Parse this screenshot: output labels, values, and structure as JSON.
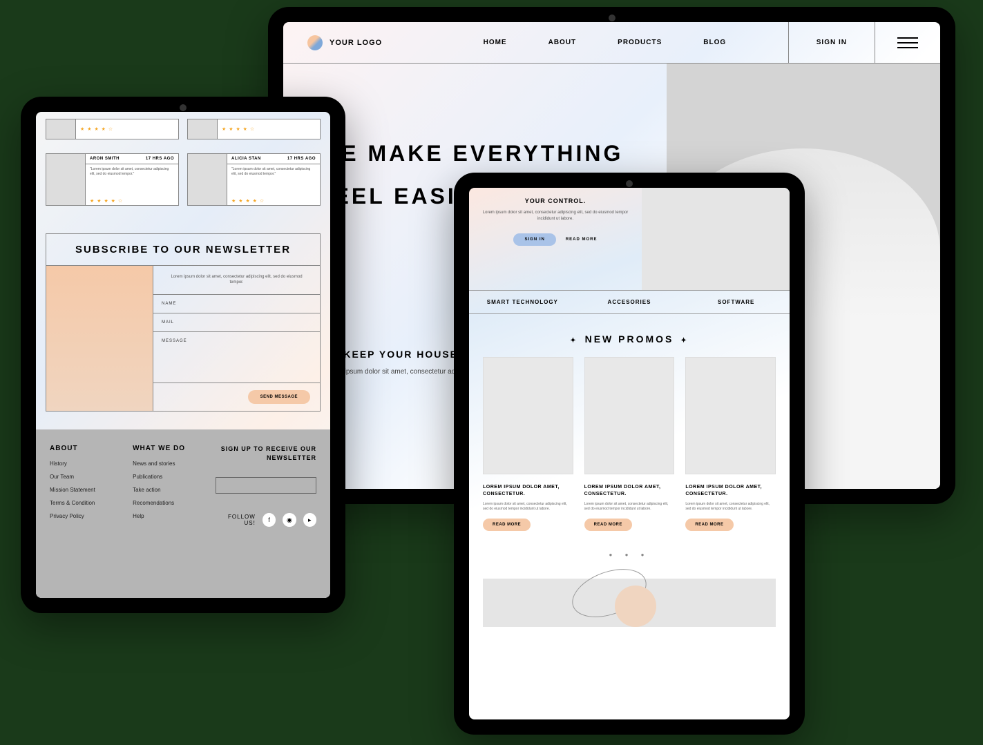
{
  "a": {
    "logo": "YOUR LOGO",
    "nav": {
      "home": "HOME",
      "about": "ABOUT",
      "products": "PRODUCTS",
      "blog": "BLOG"
    },
    "signin": "SIGN IN",
    "hero_title_1": "WE MAKE EVERYTHING",
    "hero_title_2": "FEEL EASIER",
    "sub_title": "KEEP YOUR HOUSE UNDER YOUR CONTROL.",
    "sub_body": "Lorem ipsum dolor sit amet, consectetur adipiscing elit, sed do eiusmod tempor incididunt ut labore."
  },
  "b": {
    "reviews": [
      {
        "name": "ARON SMITH",
        "time": "17 HRS AGO",
        "text": "\"Lorem ipsum dolor sit amet, consectetur adipiscing elit, sed do eiusmod tempor.\"",
        "stars": "★ ★ ★ ★ ☆"
      },
      {
        "name": "ALICIA STAN",
        "time": "17 HRS AGO",
        "text": "\"Lorem ipsum dolor sit amet, consectetur adipiscing elit, sed do eiusmod tempor.\"",
        "stars": "★ ★ ★ ★ ☆"
      }
    ],
    "top_stars": "★ ★ ★ ★ ☆",
    "newsletter": {
      "title": "SUBSCRIBE TO OUR NEWSLETTER",
      "desc": "Lorem ipsum dolor sit amet, consectetur adipiscing elit, sed do eiusmod tempor.",
      "name": "NAME",
      "mail": "MAIL",
      "message": "MESSAGE",
      "send": "SEND MESSAGE"
    },
    "footer": {
      "about_h": "ABOUT",
      "about": [
        "History",
        "Our Team",
        "Mission Statement",
        "Terms & Condition",
        "Privacy Policy"
      ],
      "what_h": "WHAT WE DO",
      "what": [
        "News and stories",
        "Publications",
        "Take action",
        "Recomendations",
        "Help"
      ],
      "signup": "SIGN UP TO RECEIVE OUR NEWSLETTER",
      "follow": "FOLLOW US!"
    }
  },
  "c": {
    "hero_title": "YOUR CONTROL.",
    "hero_body": "Lorem ipsum dolor sit amet, consectetur adipiscing elit, sed do eiusmod tempor incididunt ut labore.",
    "signin": "SIGN IN",
    "readmore": "READ MORE",
    "tabs": {
      "t1": "SMART TECHNOLOGY",
      "t2": "ACCESORIES",
      "t3": "SOFTWARE"
    },
    "promos_h": "NEW PROMOS",
    "promo": {
      "title": "LOREM IPSUM DOLOR AMET, CONSECTETUR.",
      "body": "Lorem ipsum dolor sit amet, consectetur adipiscing elit, sed do eiusmod tempor incididunt ut labore.",
      "btn": "READ MORE"
    }
  }
}
